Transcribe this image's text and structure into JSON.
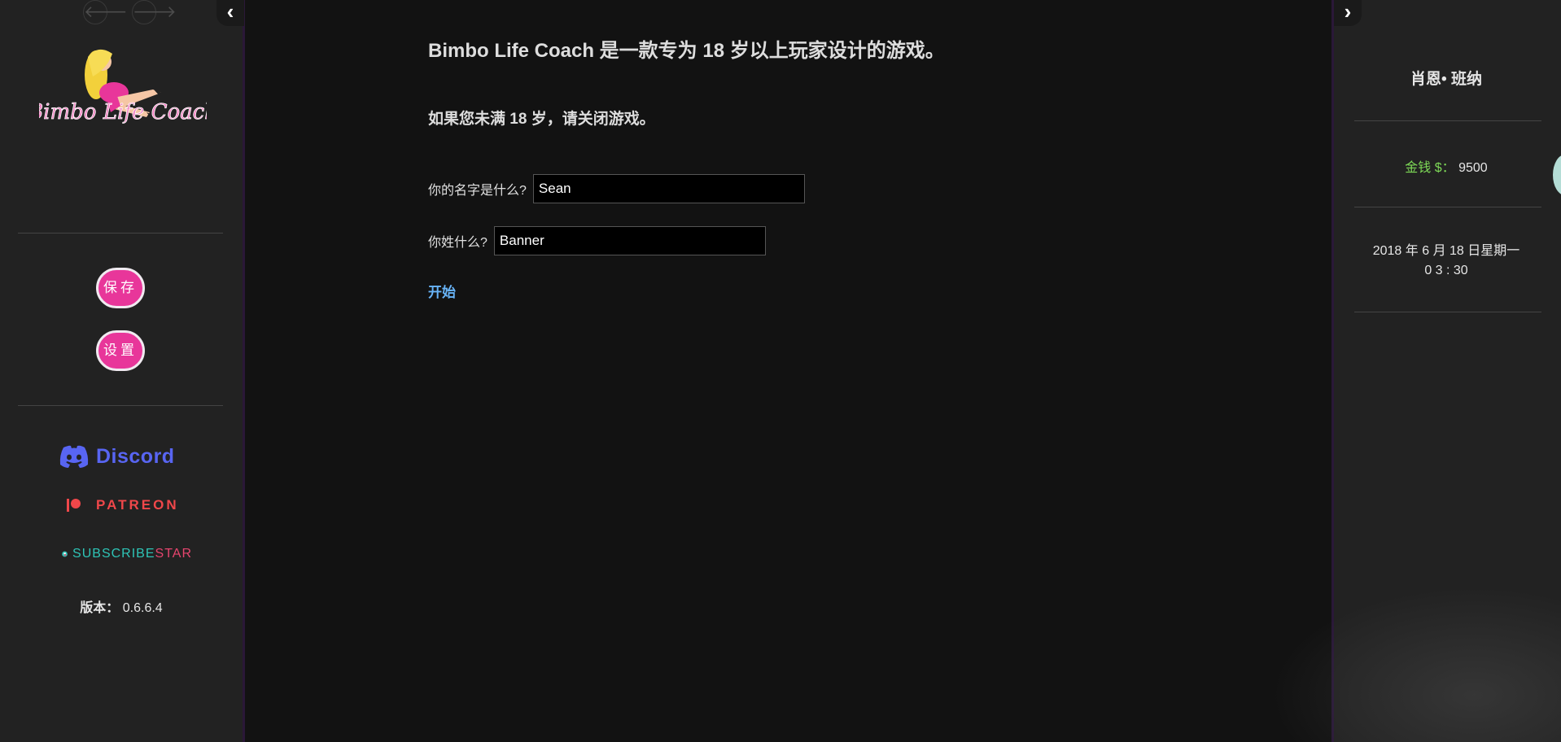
{
  "left_sidebar": {
    "nav": {
      "back_icon": "arrow-left-icon",
      "forward_icon": "arrow-right-icon",
      "toggle_icon": "chevron-left-icon"
    },
    "logo_text": "Bimbo Life Coach",
    "buttons": {
      "save_label": "保存",
      "settings_label": "设置"
    },
    "links": {
      "discord": "Discord",
      "patreon": "PATREON",
      "subscribestar_part1": "SUBSCRIBE",
      "subscribestar_part2": "STAR"
    },
    "version": {
      "label": "版本：",
      "value": "0.6.6.4"
    }
  },
  "main": {
    "title": "Bimbo Life Coach 是一款专为 18 岁以上玩家设计的游戏。",
    "warning": "如果您未满 18 岁，请关闭游戏。",
    "first_name_label": "你的名字是什么?",
    "first_name_value": "Sean",
    "last_name_label": "你姓什么?",
    "last_name_value": "Banner",
    "start_label": "开始"
  },
  "right_sidebar": {
    "toggle_icon": "chevron-right-icon",
    "player_name": "肖恩• 班纳",
    "money_label": "金钱 $：",
    "money_value": "9500",
    "date_line1": "2018 年 6 月 18 日星期一",
    "date_line2": "0 3 : 30"
  },
  "colors": {
    "background": "#121212",
    "sidebar": "#222222",
    "button_pink": "#e8369a",
    "link_blue": "#68b4f8",
    "money_green": "#7ed957",
    "discord": "#5865f2",
    "patreon": "#f0474a",
    "subscribestar_teal": "#2ec4b6",
    "subscribestar_pink": "#e6456e"
  }
}
